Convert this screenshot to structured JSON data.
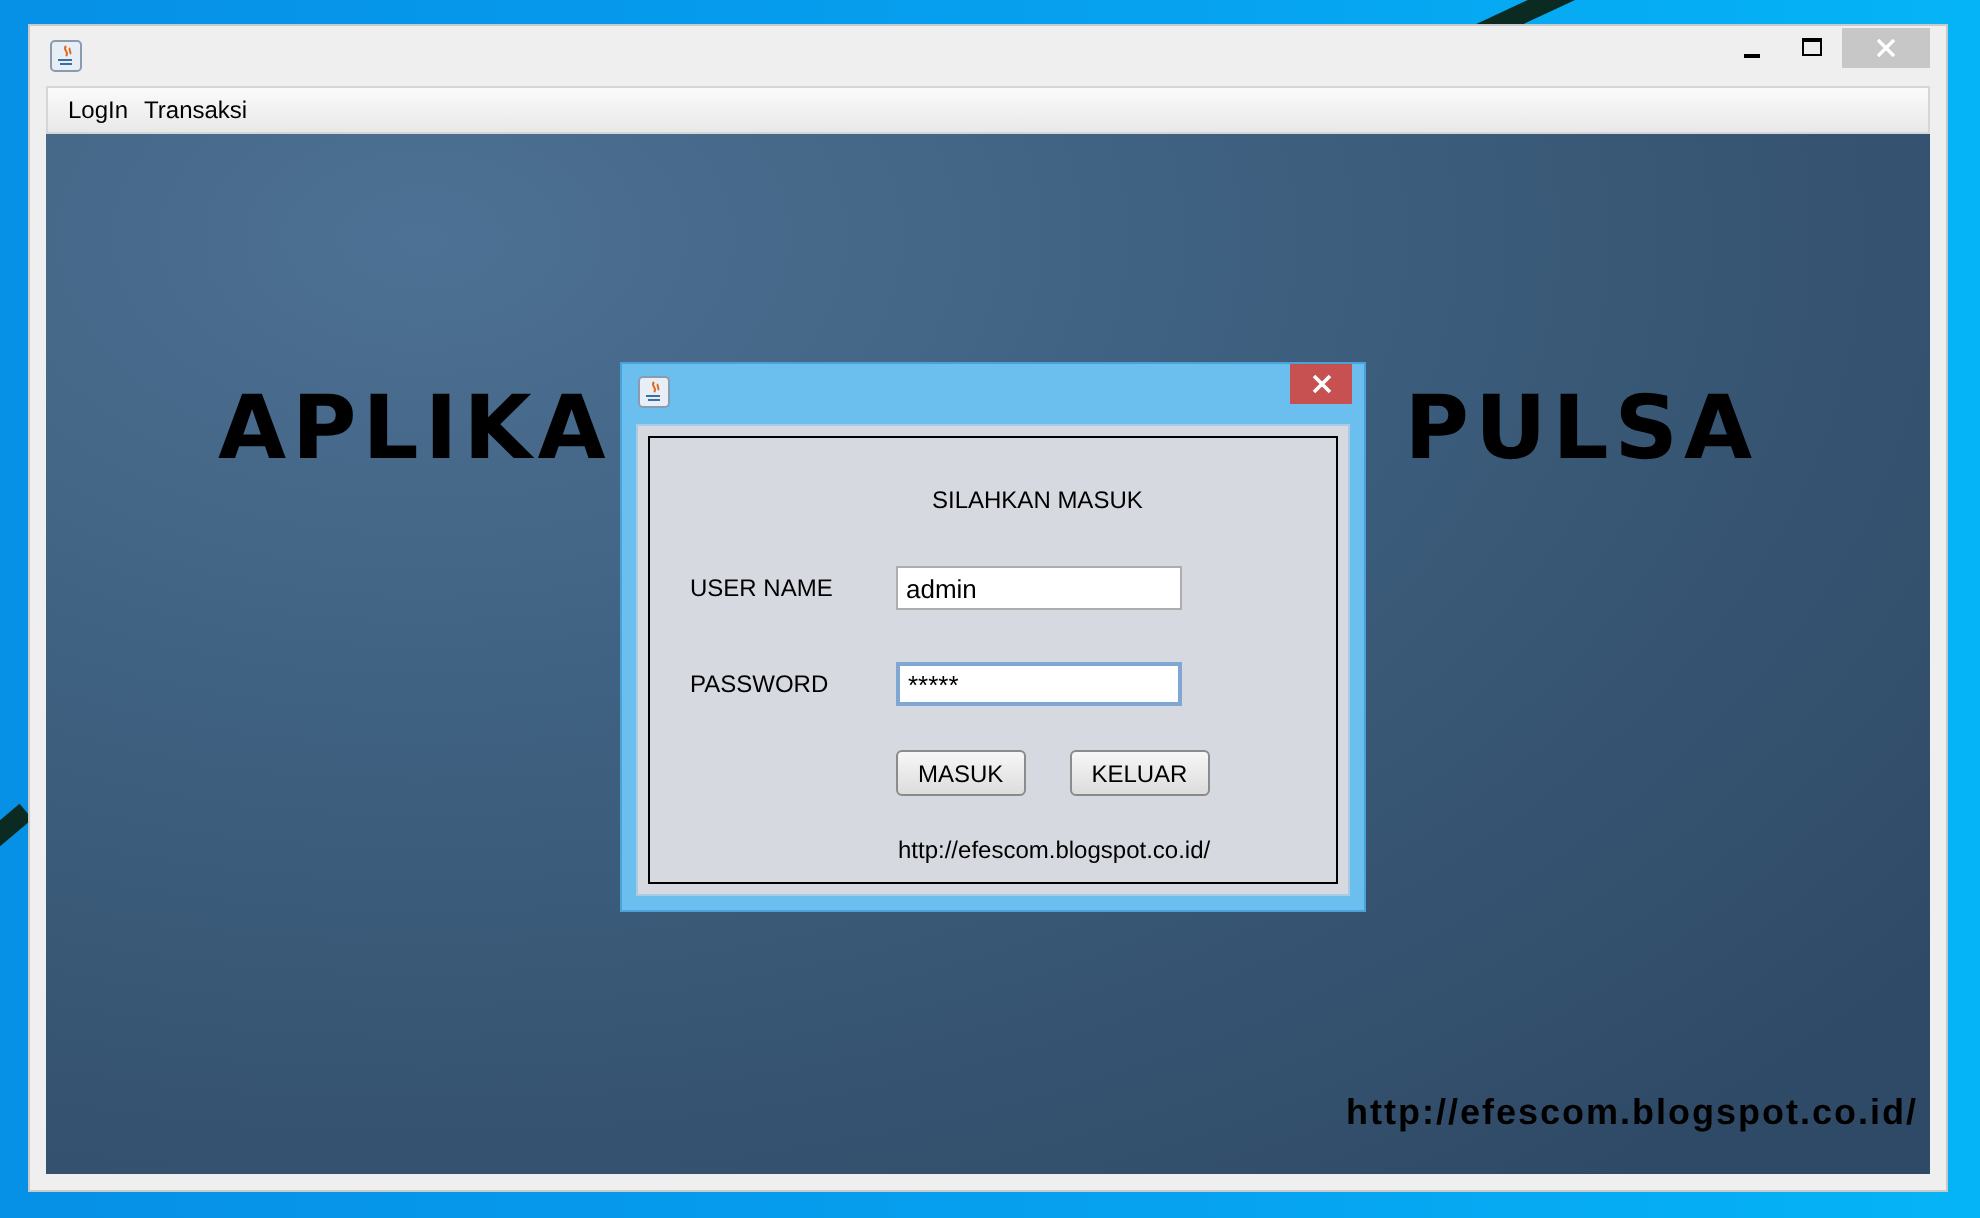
{
  "window": {
    "menu": [
      {
        "label": "LogIn"
      },
      {
        "label": "Transaksi"
      }
    ]
  },
  "banner": {
    "left_part": "APLIKA",
    "right_part": "PULSA",
    "footer_link": "http://efescom.blogspot.co.id/"
  },
  "dialog": {
    "heading": "SILAHKAN MASUK",
    "fields": [
      {
        "label": "USER NAME",
        "value": "admin",
        "focused": false
      },
      {
        "label": "PASSWORD",
        "value": "*****",
        "focused": true
      }
    ],
    "buttons": [
      "MASUK",
      "KELUAR"
    ],
    "link": "http://efescom.blogspot.co.id/"
  }
}
